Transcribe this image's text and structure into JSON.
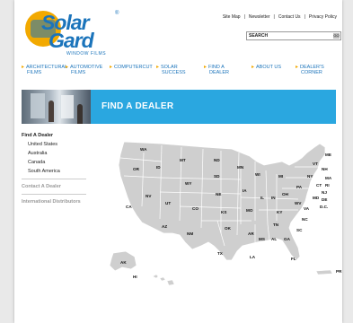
{
  "logo": {
    "line1": "Solar",
    "line2": "Gard",
    "registered": "®",
    "subtitle": "WINDOW FILMS"
  },
  "top_links": [
    "Site Map",
    "|",
    "Newsletter",
    "|",
    "Contact Us",
    "|",
    "Privacy Policy"
  ],
  "search": {
    "label": "SEARCH",
    "go": "GO"
  },
  "nav": {
    "items": [
      {
        "line1": "ARCHITECTURAL",
        "line2": "FILMS"
      },
      {
        "line1": "AUTOMOTIVE",
        "line2": "FILMS"
      },
      {
        "line1": "COMPUTERCUT",
        "line2": ""
      },
      {
        "line1": "SOLAR",
        "line2": "SUCCESS"
      },
      {
        "line1": "FIND A",
        "line2": "DEALER"
      },
      {
        "line1": "ABOUT US",
        "line2": ""
      },
      {
        "line1": "DEALER'S",
        "line2": "CORNER"
      }
    ]
  },
  "banner": {
    "title": "FIND A DEALER"
  },
  "sidebar": {
    "heading": "Find A Dealer",
    "items": [
      "United States",
      "Australia",
      "Canada",
      "South America"
    ],
    "links": [
      "Contact A Dealer",
      "International Distributors"
    ]
  },
  "map": {
    "state_labels": [
      "WA",
      "OR",
      "ID",
      "MT",
      "ND",
      "MN",
      "WI",
      "MI",
      "SD",
      "WY",
      "NE",
      "IA",
      "IL",
      "IN",
      "OH",
      "PA",
      "NY",
      "VT",
      "NH",
      "ME",
      "MA",
      "RI",
      "CT",
      "NJ",
      "DE",
      "MD",
      "D.C.",
      "WV",
      "VA",
      "NC",
      "SC",
      "GA",
      "FL",
      "AL",
      "MS",
      "TN",
      "KY",
      "MO",
      "KS",
      "CO",
      "UT",
      "NV",
      "CA",
      "AZ",
      "NM",
      "TX",
      "OK",
      "AR",
      "LA",
      "AK",
      "HI",
      "PR"
    ],
    "colors": {
      "land": "#cfcfcf",
      "border": "#ffffff"
    }
  },
  "colors": {
    "brand_blue": "#1b74bb",
    "brand_gold": "#f2a900",
    "banner_blue": "#2aa7e0"
  }
}
